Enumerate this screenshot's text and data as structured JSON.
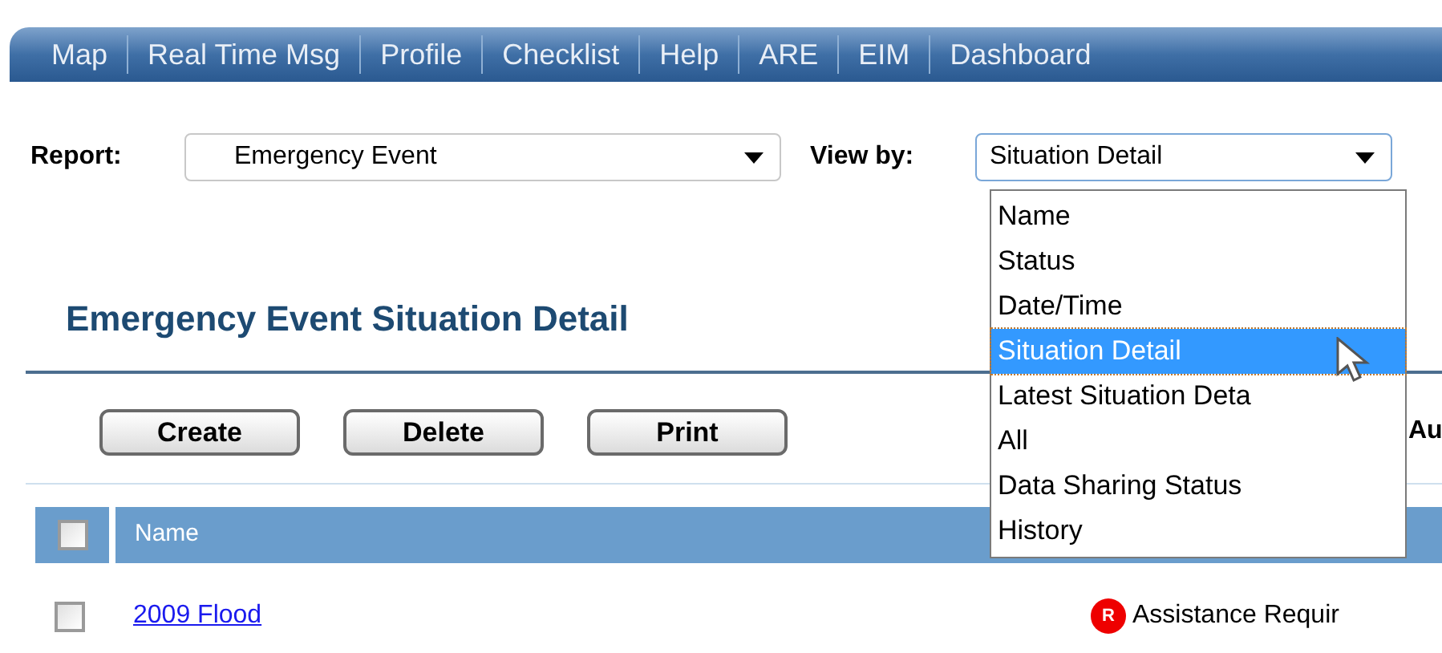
{
  "nav_tabs": [
    {
      "label": "Map"
    },
    {
      "label": "Real Time Msg"
    },
    {
      "label": "Profile"
    },
    {
      "label": "Checklist"
    },
    {
      "label": "Help"
    },
    {
      "label": "ARE"
    },
    {
      "label": "EIM"
    },
    {
      "label": "Dashboard"
    }
  ],
  "report": {
    "label": "Report:",
    "value": "Emergency Event"
  },
  "view_by": {
    "label": "View by:",
    "value": "Situation Detail",
    "expanded": true,
    "options": [
      {
        "label": "Name",
        "selected": false
      },
      {
        "label": "Status",
        "selected": false
      },
      {
        "label": "Date/Time",
        "selected": false
      },
      {
        "label": "Situation Detail",
        "selected": true
      },
      {
        "label": "Latest Situation Deta",
        "selected": false
      },
      {
        "label": "All",
        "selected": false
      },
      {
        "label": "Data Sharing Status",
        "selected": false
      },
      {
        "label": "History",
        "selected": false
      }
    ]
  },
  "title": "Emergency Event Situation Detail",
  "buttons": [
    "Create",
    "Delete",
    "Print"
  ],
  "side_label": "Au",
  "table": {
    "header_checked": false,
    "columns": [
      "Name"
    ],
    "rows": [
      {
        "checked": false,
        "name": "2009 Flood",
        "status_badge": "R",
        "status": "Assistance Requir"
      }
    ]
  }
}
